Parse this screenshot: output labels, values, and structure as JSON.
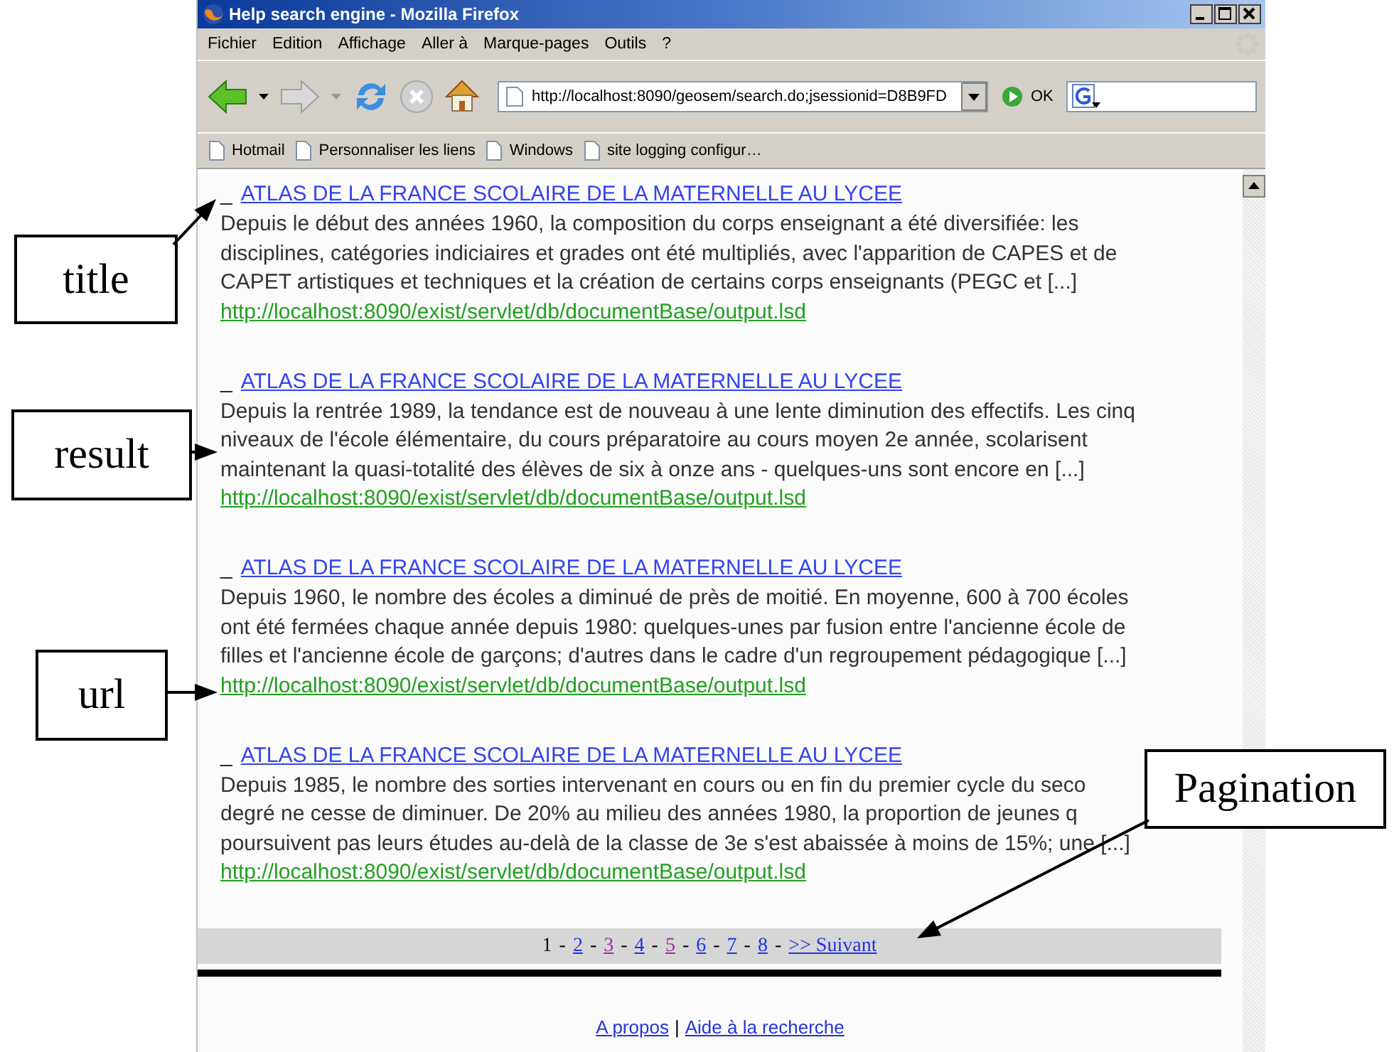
{
  "window": {
    "title": "Help search engine - Mozilla Firefox"
  },
  "menu": [
    "Fichier",
    "Edition",
    "Affichage",
    "Aller à",
    "Marque-pages",
    "Outils",
    "?"
  ],
  "toolbar": {
    "address": "http://localhost:8090/geosem/search.do;jsessionid=D8B9FD",
    "go_label": "OK"
  },
  "bookmarks": [
    "Hotmail",
    "Personnaliser les liens",
    "Windows",
    "site logging configur…"
  ],
  "results": [
    {
      "bullet": "_",
      "title": "ATLAS DE LA FRANCE SCOLAIRE DE LA MATERNELLE AU LYCEE",
      "lines": [
        "Depuis le début des années 1960, la composition du corps enseignant a été diversifiée: les",
        "disciplines, catégories indiciaires et grades ont été multipliés, avec l'apparition de CAPES et de",
        "CAPET artistiques et techniques et la création de certains corps enseignants (PEGC et [...]"
      ],
      "url": "http://localhost:8090/exist/servlet/db/documentBase/output.lsd"
    },
    {
      "bullet": "_",
      "title": "ATLAS DE LA FRANCE SCOLAIRE DE LA MATERNELLE AU LYCEE",
      "lines": [
        "Depuis la rentrée 1989, la tendance est de nouveau à une lente diminution des effectifs. Les cinq",
        "niveaux de l'école élémentaire, du cours préparatoire au cours moyen 2e année, scolarisent",
        "maintenant la quasi-totalité des élèves de six à onze ans - quelques-uns sont encore en [...]"
      ],
      "url": "http://localhost:8090/exist/servlet/db/documentBase/output.lsd"
    },
    {
      "bullet": "_",
      "title": "ATLAS DE LA FRANCE SCOLAIRE DE LA MATERNELLE AU LYCEE",
      "lines": [
        "Depuis 1960, le nombre des écoles a diminué de près de moitié. En moyenne, 600 à 700 écoles",
        "ont été fermées chaque année depuis 1980: quelques-unes par fusion entre l'ancienne école de",
        "filles et l'ancienne école de garçons; d'autres dans le cadre d'un regroupement pédagogique [...]"
      ],
      "url": "http://localhost:8090/exist/servlet/db/documentBase/output.lsd"
    },
    {
      "bullet": "_",
      "title": "ATLAS DE LA FRANCE SCOLAIRE DE LA MATERNELLE AU LYCEE",
      "lines": [
        "Depuis 1985, le nombre des sorties intervenant en cours ou en fin du premier cycle du seco",
        "degré ne cesse de diminuer. De 20% au milieu des années 1980, la proportion de jeunes q",
        "poursuivent pas leurs études au-delà de la classe de 3e s'est abaissée à moins de 15%; une [...]"
      ],
      "url": "http://localhost:8090/exist/servlet/db/documentBase/output.lsd"
    }
  ],
  "pagination": {
    "separator": "-",
    "items": [
      {
        "label": "1",
        "selected": true,
        "visited": false
      },
      {
        "label": "2",
        "selected": false,
        "visited": false
      },
      {
        "label": "3",
        "selected": false,
        "visited": true
      },
      {
        "label": "4",
        "selected": false,
        "visited": false
      },
      {
        "label": "5",
        "selected": false,
        "visited": true
      },
      {
        "label": "6",
        "selected": false,
        "visited": false
      },
      {
        "label": "7",
        "selected": false,
        "visited": false
      },
      {
        "label": "8",
        "selected": false,
        "visited": false
      },
      {
        "label": ">> Suivant",
        "selected": false,
        "visited": false
      }
    ]
  },
  "footer": {
    "links": [
      "A propos",
      "Aide à la recherche"
    ],
    "separator": "|"
  },
  "annotations": [
    {
      "label": "title"
    },
    {
      "label": "result"
    },
    {
      "label": "url"
    },
    {
      "label": "Pagination"
    }
  ]
}
